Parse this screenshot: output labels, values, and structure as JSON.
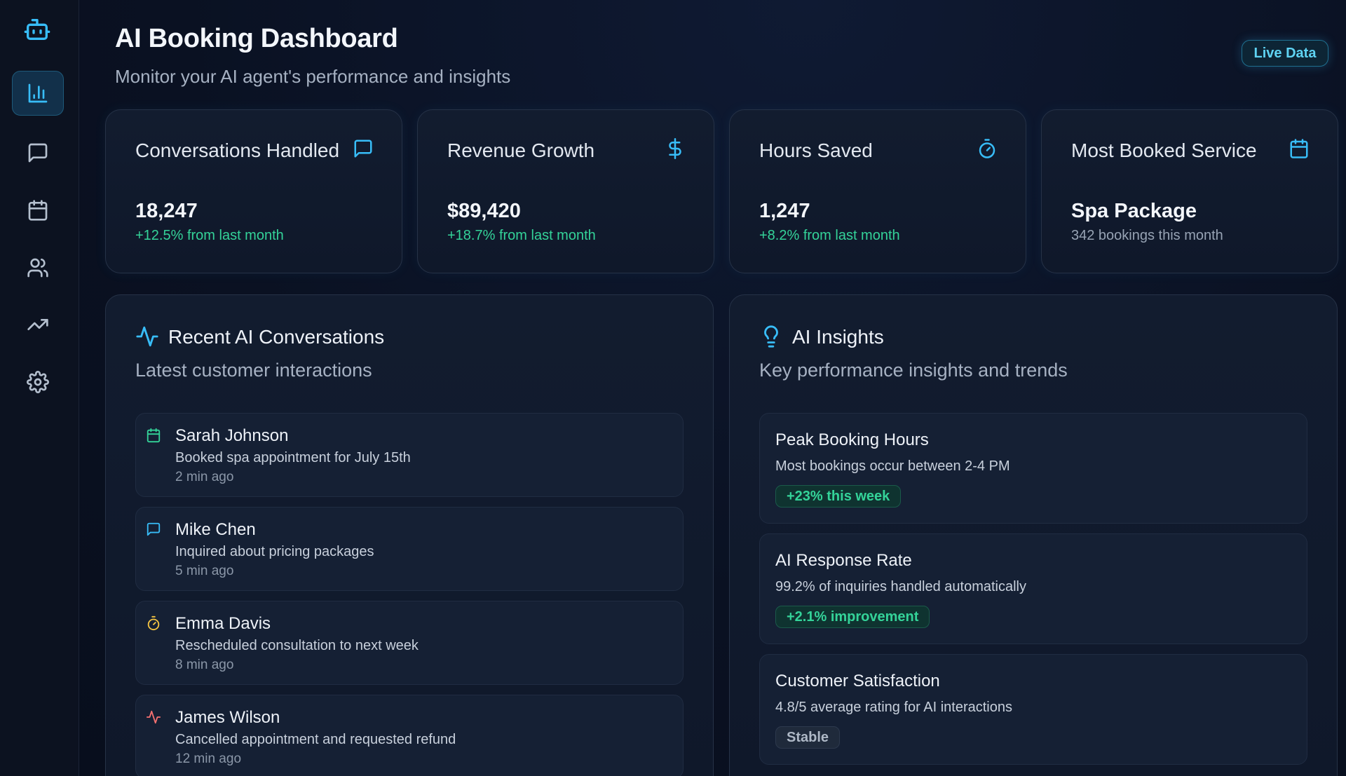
{
  "header": {
    "title": "AI Booking Dashboard",
    "subtitle": "Monitor your AI agent's performance and insights",
    "badge": "Live Data"
  },
  "sidebar": {
    "items": [
      {
        "name": "analytics",
        "icon": "bar-chart-icon",
        "active": true
      },
      {
        "name": "messages",
        "icon": "message-square-icon",
        "active": false
      },
      {
        "name": "calendar",
        "icon": "calendar-icon",
        "active": false
      },
      {
        "name": "users",
        "icon": "users-icon",
        "active": false
      },
      {
        "name": "trends",
        "icon": "trending-up-icon",
        "active": false
      },
      {
        "name": "settings",
        "icon": "gear-icon",
        "active": false
      }
    ]
  },
  "stats": [
    {
      "label": "Conversations Handled",
      "icon": "message-square-icon",
      "value": "18,247",
      "delta": "+12.5% from last month"
    },
    {
      "label": "Revenue Growth",
      "icon": "dollar-icon",
      "value": "$89,420",
      "delta": "+18.7% from last month"
    },
    {
      "label": "Hours Saved",
      "icon": "timer-icon",
      "value": "1,247",
      "delta": "+8.2% from last month"
    },
    {
      "label": "Most Booked Service",
      "icon": "calendar-icon",
      "value": "Spa Package",
      "delta": "342 bookings this month"
    }
  ],
  "conversations": {
    "title": "Recent AI Conversations",
    "subtitle": "Latest customer interactions",
    "items": [
      {
        "name": "Sarah Johnson",
        "description": "Booked spa appointment for July 15th",
        "time": "2 min ago",
        "icon": "calendar-icon",
        "color": "#34d399"
      },
      {
        "name": "Mike Chen",
        "description": "Inquired about pricing packages",
        "time": "5 min ago",
        "icon": "message-square-icon",
        "color": "#38bdf8"
      },
      {
        "name": "Emma Davis",
        "description": "Rescheduled consultation to next week",
        "time": "8 min ago",
        "icon": "timer-icon",
        "color": "#f5c542"
      },
      {
        "name": "James Wilson",
        "description": "Cancelled appointment and requested refund",
        "time": "12 min ago",
        "icon": "activity-icon",
        "color": "#f87171"
      }
    ]
  },
  "insights": {
    "title": "AI Insights",
    "subtitle": "Key performance insights and trends",
    "items": [
      {
        "title": "Peak Booking Hours",
        "description": "Most bookings occur between 2-4 PM",
        "tag": "+23% this week",
        "tag_style": "green"
      },
      {
        "title": "AI Response Rate",
        "description": "99.2% of inquiries handled automatically",
        "tag": "+2.1% improvement",
        "tag_style": "green"
      },
      {
        "title": "Customer Satisfaction",
        "description": "4.8/5 average rating for AI interactions",
        "tag": "Stable",
        "tag_style": "gray"
      }
    ]
  },
  "colors": {
    "accent": "#38bdf8",
    "positive": "#34d399",
    "background": "#0a1122",
    "card": "#121c2f"
  }
}
